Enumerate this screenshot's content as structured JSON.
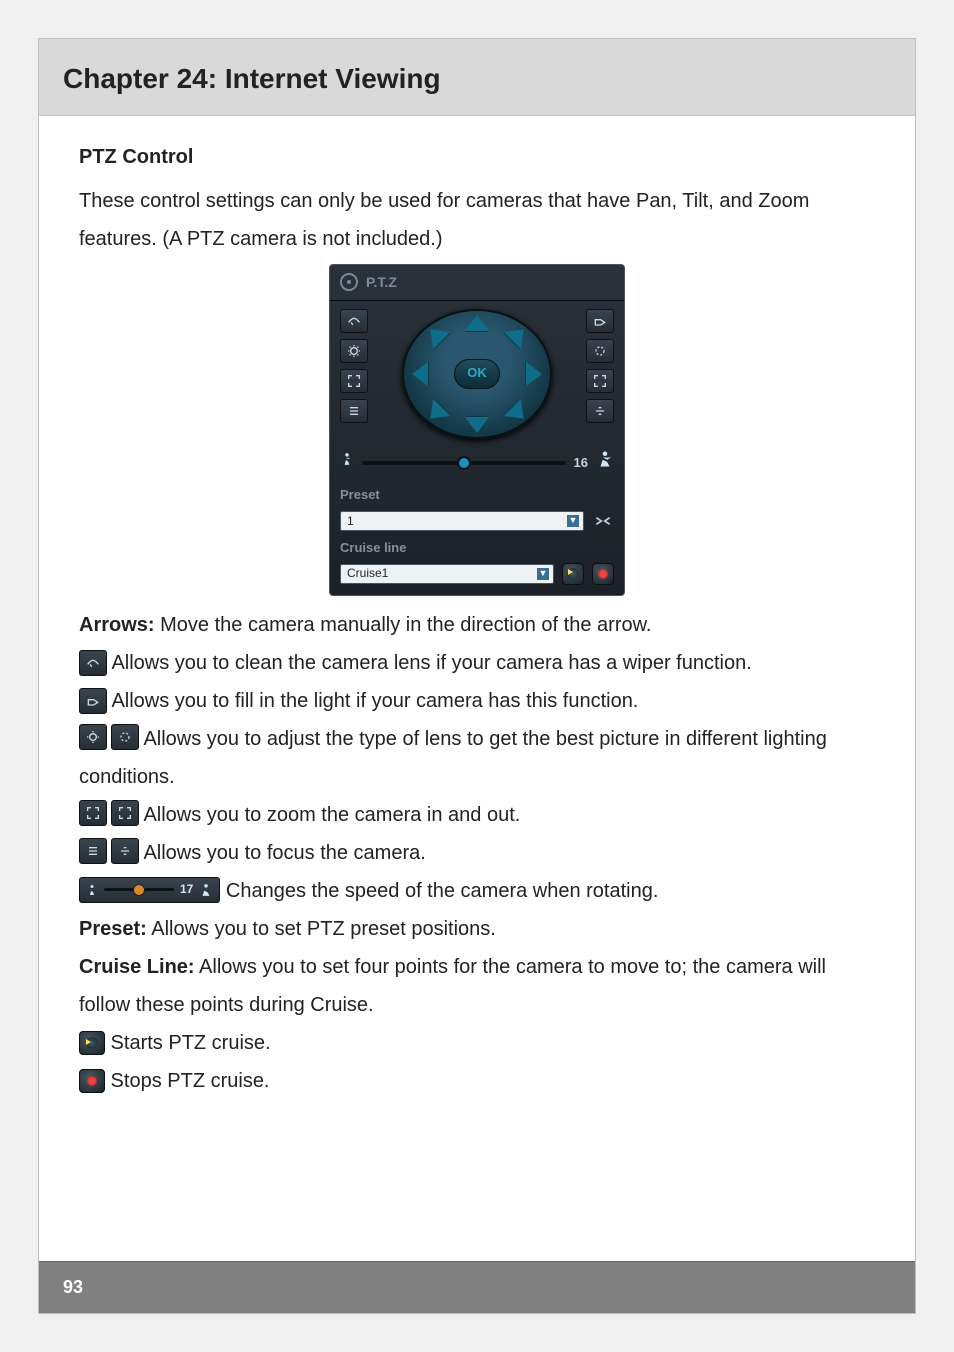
{
  "chapter_title": "Chapter 24: Internet Viewing",
  "page_number": "93",
  "section_title": "PTZ Control",
  "intro_text": "These control settings can only be used for cameras that have Pan, Tilt, and Zoom features. (A PTZ camera is not included.)",
  "ptz_panel": {
    "title": "P.T.Z",
    "ok_label": "OK",
    "speed_value": "16",
    "preset_label": "Preset",
    "preset_value": "1",
    "cruise_label": "Cruise line",
    "cruise_value": "Cruise1"
  },
  "descriptions": {
    "arrows_label": "Arrows:",
    "arrows_text": " Move the camera manually in the direction of the arrow.",
    "wiper_text": " Allows you to clean the camera lens if your camera has a wiper function.",
    "light_text": " Allows you to fill in the light if your camera has this function.",
    "iris_text": " Allows you to adjust the type of lens to get the best picture in different lighting conditions.",
    "zoom_text": " Allows you to zoom the camera in and out.",
    "focus_text": " Allows you to focus the camera.",
    "speed_inline_value": "17",
    "speed_text": " Changes the speed of the camera when rotating.",
    "preset_label": "Preset:",
    "preset_text": " Allows you to set PTZ preset positions.",
    "cruise_label": "Cruise Line:",
    "cruise_text": " Allows you to set four points for the camera to move to; the camera will follow these points during Cruise.",
    "start_cruise_text": " Starts PTZ cruise.",
    "stop_cruise_text": " Stops PTZ cruise."
  }
}
